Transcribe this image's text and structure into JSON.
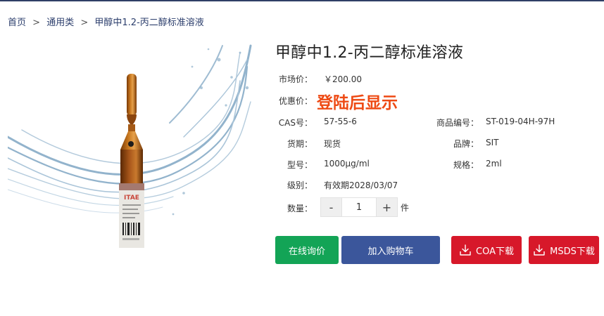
{
  "breadcrumb": {
    "home": "首页",
    "category": "通用类",
    "current": "甲醇中1.2-丙二醇标准溶液",
    "separator": ">"
  },
  "product": {
    "title": "甲醇中1.2-丙二醇标准溶液",
    "image_alt": "甲醇中1.2-丙二醇标准溶液",
    "market_price_label": "市场价：",
    "market_price": "￥200.00",
    "promo_label": "优惠价：",
    "promo_text": "登陆后显示",
    "cas_label": "CAS号：",
    "cas": "57-55-6",
    "code_label": "商品编号：",
    "code": "ST-019-04H-97H",
    "stock_label": "货期：",
    "stock": "现货",
    "brand_label": "品牌：",
    "brand": "SIT",
    "model_label": "型号：",
    "model": "1000μg/ml",
    "spec_label": "规格：",
    "spec": "2ml",
    "grade_label": "级别：",
    "grade": "有效期2028/03/07"
  },
  "quantity": {
    "label": "数量：",
    "minus": "-",
    "plus": "+",
    "value": "1",
    "unit": "件"
  },
  "actions": {
    "inquiry": "在线询价",
    "cart": "加入购物车",
    "coa": "COA下载",
    "msds": "MSDS下载",
    "download_icon": "download-icon"
  },
  "colors": {
    "green": "#13a456",
    "blue": "#3b569b",
    "red": "#d7182a",
    "promo": "#ee4a14",
    "breadcrumb": "#2d3f6d"
  }
}
